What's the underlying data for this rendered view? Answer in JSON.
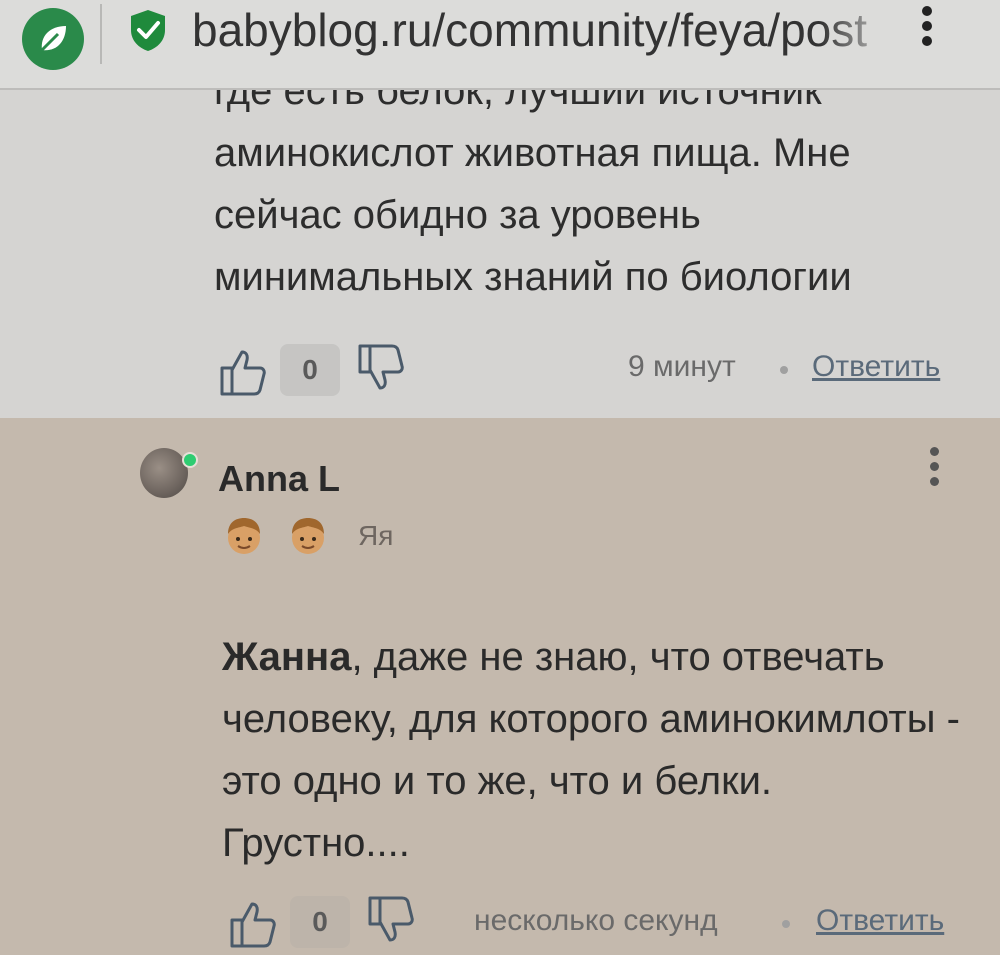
{
  "address_bar": {
    "url": "babyblog.ru/community/feya/post"
  },
  "comment_prev": {
    "text_lines": [
      "где есть белок, лучший источник",
      "аминокислот животная пища. Мне",
      "сейчас обидно за уровень",
      "минимальных знаний по биологии"
    ],
    "likes": "0",
    "time": "9 минут",
    "reply_label": "Ответить"
  },
  "comment_current": {
    "author": "Anna L",
    "badge_label": "Яя",
    "mention": "Жанна",
    "text": ", даже не знаю, что отвечать человеку, для которого аминокимлоты - это одно и то же, что и белки. Грустно....",
    "likes": "0",
    "time": "несколько секунд",
    "reply_label": "Ответить"
  }
}
